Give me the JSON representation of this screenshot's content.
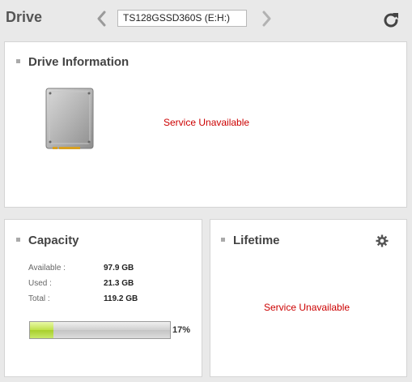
{
  "header": {
    "title": "Drive",
    "selected_drive": "TS128GSSD360S (E:H:)"
  },
  "drive_info": {
    "title": "Drive Information",
    "status": "Service Unavailable"
  },
  "capacity": {
    "title": "Capacity",
    "rows": [
      {
        "label": "Available :",
        "value": "97.9 GB"
      },
      {
        "label": "Used :",
        "value": "21.3 GB"
      },
      {
        "label": "Total :",
        "value": "119.2 GB"
      }
    ],
    "used_percent": 17,
    "used_percent_text": "17%"
  },
  "lifetime": {
    "title": "Lifetime",
    "status": "Service Unavailable"
  },
  "colors": {
    "background": "#e9e9e9",
    "panel": "#ffffff",
    "unavailable_text": "#cc0000",
    "bar_fill": "#bfe04a"
  },
  "icons": [
    "chevron-left-icon",
    "chevron-right-icon",
    "refresh-icon",
    "ssd-drive-icon",
    "gear-icon"
  ]
}
